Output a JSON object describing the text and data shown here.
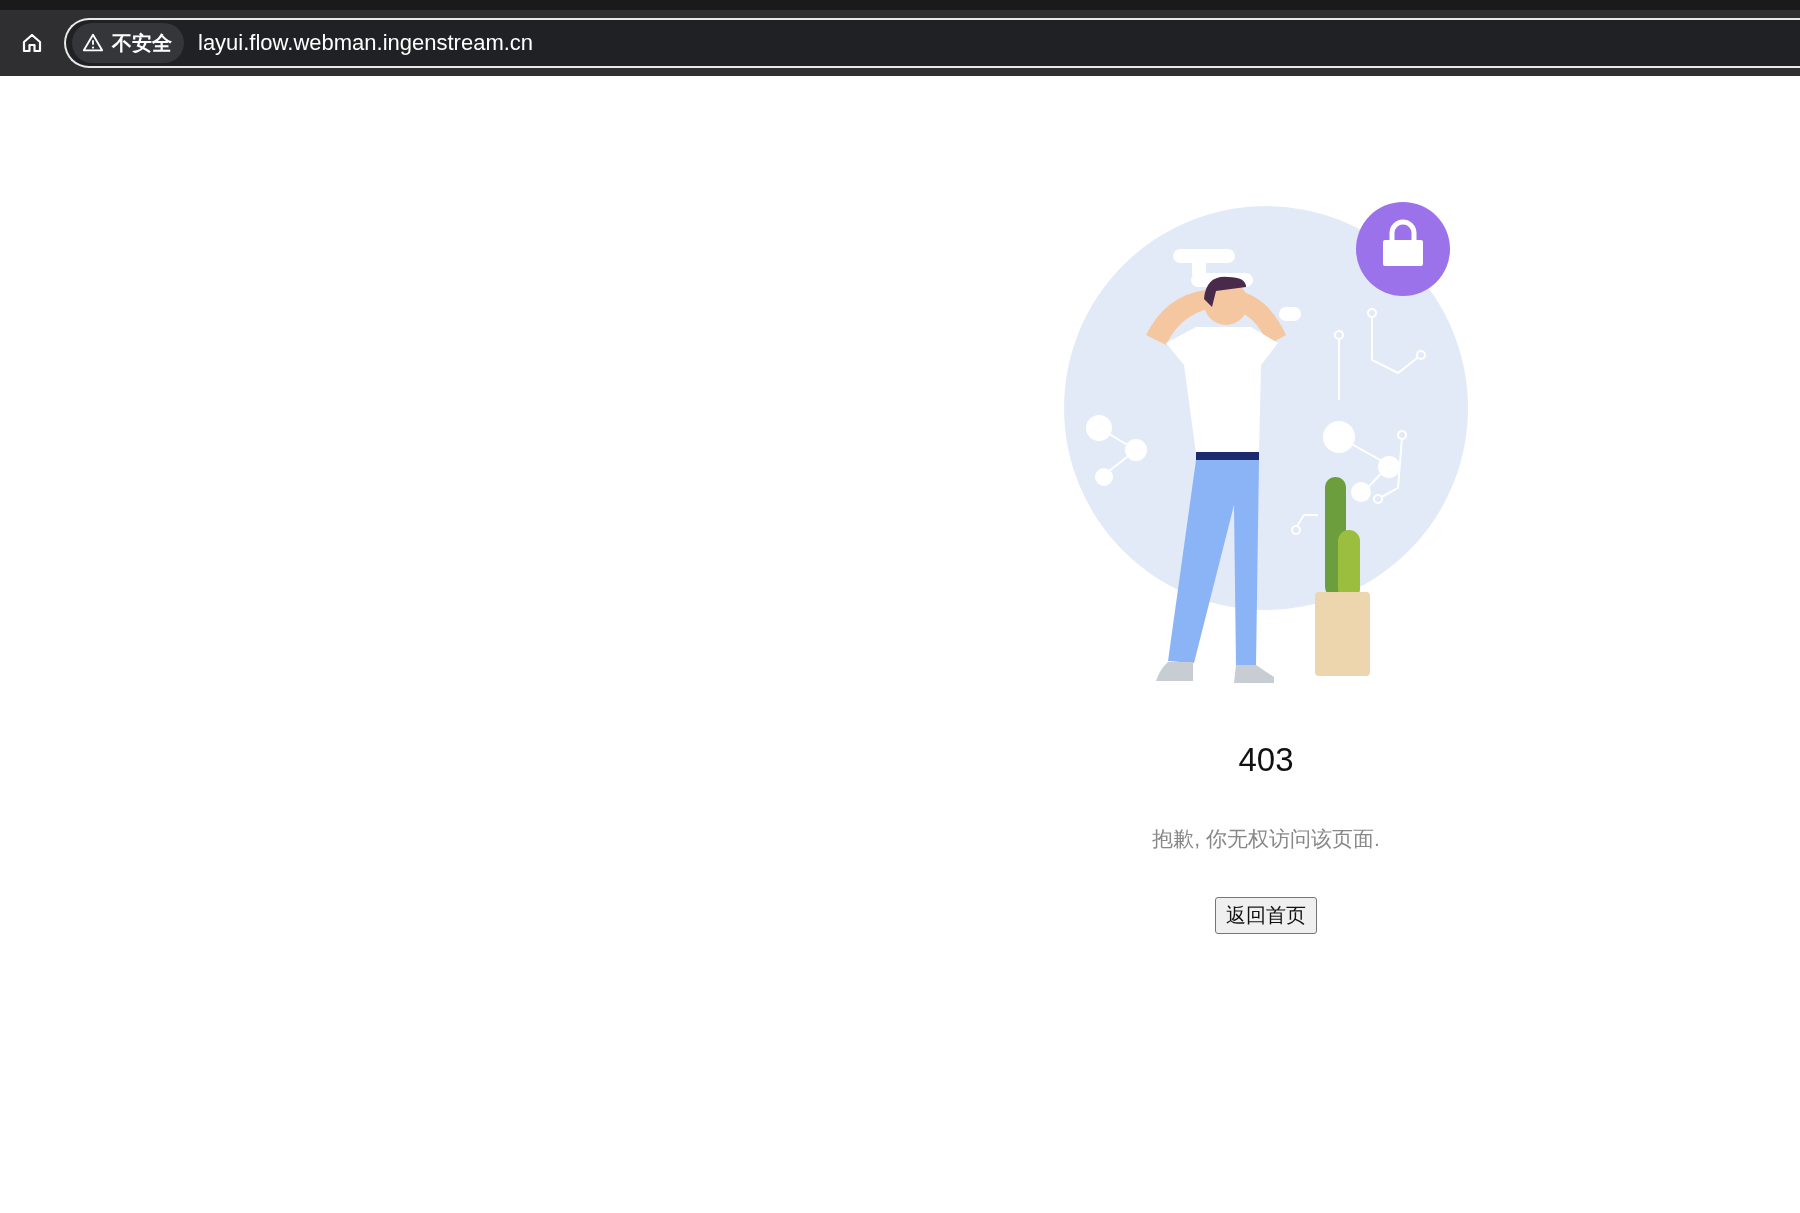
{
  "browser": {
    "security_label": "不安全",
    "url": "layui.flow.webman.ingenstream.cn"
  },
  "error": {
    "code": "403",
    "message": "抱歉, 你无权访问该页面.",
    "button": "返回首页"
  }
}
